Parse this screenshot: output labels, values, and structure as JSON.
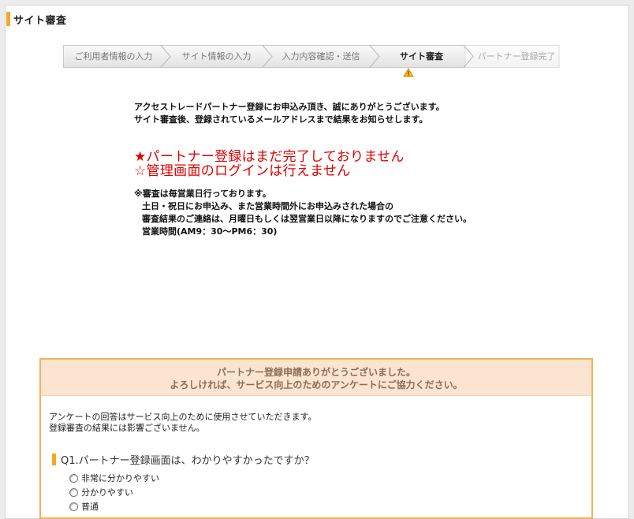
{
  "header": {
    "title": "サイト審査"
  },
  "steps": [
    {
      "label": "ご利用者情報の入力",
      "active": false
    },
    {
      "label": "サイト情報の入力",
      "active": false
    },
    {
      "label": "入力内容確認・送信",
      "active": false
    },
    {
      "label": "サイト審査",
      "active": true
    },
    {
      "label": "パートナー登録完了",
      "active": false
    }
  ],
  "intro": {
    "line1": "アクセストレードパートナー登録にお申込み頂き、誠にありがとうございます。",
    "line2": "サイト審査後、登録されているメールアドレスまで結果をお知らせします。"
  },
  "warning": {
    "line1": "★パートナー登録はまだ完了しておりません",
    "line2": "☆管理画面のログインは行えません"
  },
  "notes": {
    "line1": "※審査は毎営業日行っております。",
    "line2": "土日・祝日にお申込み、また営業時間外にお申込みされた場合の",
    "line3": "審査結果のご連絡は、月曜日もしくは翌営業日以降になりますのでご注意ください。",
    "line4": "営業時間(AM9：30～PM6：30)"
  },
  "survey": {
    "heading1": "パートナー登録申請ありがとうございました。",
    "heading2": "よろしければ、サービス向上のためのアンケートにご協力ください。",
    "desc1": "アンケートの回答はサービス向上のために使用させていただきます。",
    "desc2": "登録審査の結果には影響ございません。",
    "q1": {
      "text": "Q1.パートナー登録画面は、わかりやすかったですか？",
      "options": [
        "非常に分かりやすい",
        "分かりやすい",
        "普通"
      ]
    }
  },
  "colors": {
    "accent": "#f5a623",
    "warning": "#e00000",
    "survey_border": "#f0b25a",
    "survey_head_bg": "#fbe4d0"
  }
}
